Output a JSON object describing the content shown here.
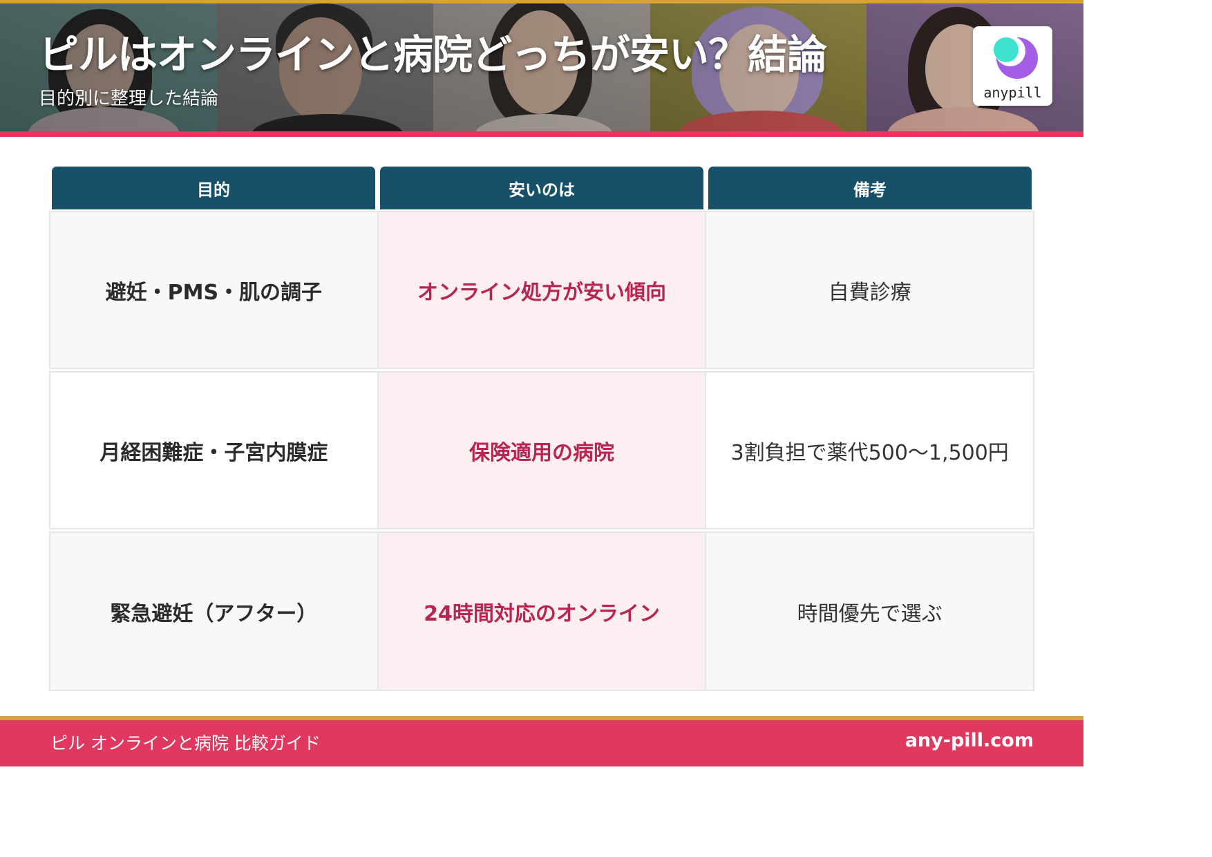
{
  "header": {
    "title": "ピルはオンラインと病院どっちが安い？結論",
    "subtitle": "目的別に整理した結論",
    "photos": [
      {
        "name": "woman-photo-1",
        "bg": "#6f a5a1"
      },
      {
        "name": "woman-photo-2",
        "bg": "#8c8c8c"
      },
      {
        "name": "woman-photo-3",
        "bg": "#b9b0a8"
      },
      {
        "name": "woman-photo-4",
        "bg": "#9a8e40"
      },
      {
        "name": "woman-photo-5",
        "bg": "#80658d"
      }
    ],
    "logo": {
      "text": "anypill",
      "icon": "crescent-moon-logo-icon",
      "colors": {
        "purple": "#a45ee6",
        "mint": "#3ee3cf"
      }
    }
  },
  "table": {
    "headers": [
      "目的",
      "安いのは",
      "備考"
    ],
    "rows": [
      {
        "purpose": "避妊・PMS・肌の調子",
        "cheaper": "オンライン処方が安い傾向",
        "note": "自費診療"
      },
      {
        "purpose": "月経困難症・子宮内膜症",
        "cheaper": "保険適用の病院",
        "note": "3割負担で薬代500〜1,500円"
      },
      {
        "purpose": "緊急避妊（アフター）",
        "cheaper": "24時間対応のオンライン",
        "note": "時間優先で選ぶ"
      }
    ]
  },
  "footer": {
    "left_text": "ピル オンラインと病院 比較ガイド",
    "site": "any-pill.com"
  },
  "colors": {
    "header_bar": "#165069",
    "accent_pink": "#e0385f",
    "accent_gold": "#d8a13a",
    "highlight_text": "#b8264f",
    "highlight_bg": "#fdeef1"
  }
}
